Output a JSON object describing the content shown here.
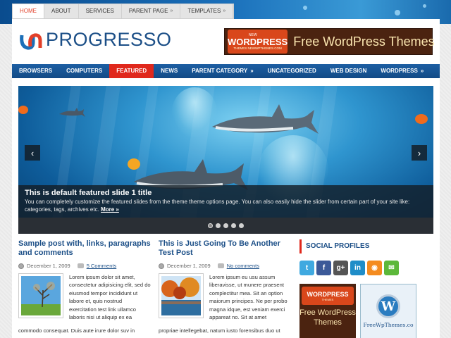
{
  "top_nav": [
    {
      "label": "HOME",
      "active": true,
      "arrow": false
    },
    {
      "label": "ABOUT",
      "active": false,
      "arrow": false
    },
    {
      "label": "SERVICES",
      "active": false,
      "arrow": false
    },
    {
      "label": "PARENT PAGE",
      "active": false,
      "arrow": true
    },
    {
      "label": "TEMPLATES",
      "active": false,
      "arrow": true
    }
  ],
  "logo": {
    "text": "PROGRESSO"
  },
  "banner": {
    "badge_top": "NEW",
    "badge_word": "WORDPRESS",
    "badge_sub": "THEMES NEWWPTHEMES.COM",
    "text": "Free WordPress Themes"
  },
  "main_nav": [
    {
      "label": "BROWSERS",
      "active": false,
      "arrow": false
    },
    {
      "label": "COMPUTERS",
      "active": false,
      "arrow": false
    },
    {
      "label": "FEATURED",
      "active": true,
      "arrow": false
    },
    {
      "label": "NEWS",
      "active": false,
      "arrow": false
    },
    {
      "label": "PARENT CATEGORY",
      "active": false,
      "arrow": true
    },
    {
      "label": "UNCATEGORIZED",
      "active": false,
      "arrow": false
    },
    {
      "label": "WEB DESIGN",
      "active": false,
      "arrow": false
    },
    {
      "label": "WORDPRESS",
      "active": false,
      "arrow": true
    }
  ],
  "slider": {
    "title": "This is default featured slide 1 title",
    "text": "You can completely customize the featured slides from the theme theme options page. You can also easily hide the slider from certain part of your site like: categories, tags, archives etc.",
    "more": "More »",
    "prev": "‹",
    "next": "›",
    "dots": 5,
    "active_dot": 0
  },
  "posts": [
    {
      "title": "Sample post with, links, paragraphs and comments",
      "date": "December 1, 2009",
      "comments": "5 Comments",
      "excerpt": "Lorem ipsum dolor sit amet, consectetur adipisicing elit, sed do eiusmod tempor incididunt ut labore et, quis nostrud exercitation test link ullamco laboris nisi ut aliquip ex ea",
      "excerpt_tail": "commodo consequat. Duis aute irure dolor suv in"
    },
    {
      "title": "This is Just Going To Be Another Test Post",
      "date": "December 1, 2009",
      "comments": "No comments",
      "excerpt": "Lorem ipsum eu usu assum liberavisse, ut munere praesent complectitur mea. Sit an option maiorum principes. Ne per probo magna idque, est veniam exerci appareat no. Sit at amet",
      "excerpt_tail": "propriae intellegebat, natum iusto forensibus duo ut"
    }
  ],
  "sidebar": {
    "title": "SOCIAL PROFILES",
    "social": [
      {
        "icon": "twitter-icon",
        "glyph": "t",
        "color": "#3fa9e0"
      },
      {
        "icon": "facebook-icon",
        "glyph": "f",
        "color": "#3b5998"
      },
      {
        "icon": "google-plus-icon",
        "glyph": "g+",
        "color": "#555555"
      },
      {
        "icon": "linkedin-icon",
        "glyph": "in",
        "color": "#1f8dc8"
      },
      {
        "icon": "rss-icon",
        "glyph": "◉",
        "color": "#f48b1f"
      },
      {
        "icon": "email-icon",
        "glyph": "✉",
        "color": "#5cb83a"
      }
    ],
    "ad1": {
      "badge_word": "WORDPRESS",
      "badge_sub": "THEMES",
      "text": "Free WordPress Themes"
    },
    "ad2": {
      "text": "FreeWpThemes.co",
      "glyph": "W"
    }
  },
  "colors": {
    "accent": "#e0281c",
    "brand": "#1c4f87"
  }
}
